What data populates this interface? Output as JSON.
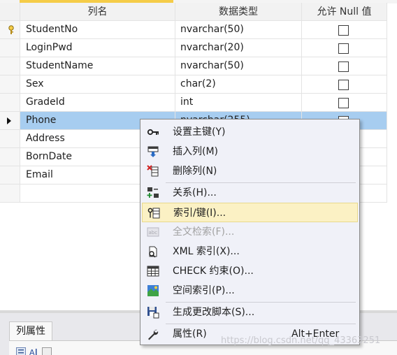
{
  "grid": {
    "headers": [
      "列名",
      "数据类型",
      "允许 Null 值"
    ],
    "rows": [
      {
        "name": "StudentNo",
        "type": "nvarchar(50)",
        "allow_null": false
      },
      {
        "name": "LoginPwd",
        "type": "nvarchar(20)",
        "allow_null": false
      },
      {
        "name": "StudentName",
        "type": "nvarchar(50)",
        "allow_null": false
      },
      {
        "name": "Sex",
        "type": "char(2)",
        "allow_null": false
      },
      {
        "name": "GradeId",
        "type": "int",
        "allow_null": false
      },
      {
        "name": "Phone",
        "type": "nvarchar(255)",
        "allow_null": false
      },
      {
        "name": "Address",
        "type": "",
        "allow_null": false
      },
      {
        "name": "BornDate",
        "type": "",
        "allow_null": false
      },
      {
        "name": "Email",
        "type": "",
        "allow_null": false
      }
    ]
  },
  "context_menu": {
    "items": [
      {
        "label": "设置主键(Y)",
        "icon": "primary-key-icon"
      },
      {
        "label": "插入列(M)",
        "icon": "insert-column-icon"
      },
      {
        "label": "删除列(N)",
        "icon": "delete-column-icon"
      },
      {
        "label": "关系(H)...",
        "icon": "relationships-icon"
      },
      {
        "label": "索引/键(I)...",
        "icon": "indexes-keys-icon"
      },
      {
        "label": "全文检索(F)...",
        "icon": "fulltext-index-icon",
        "disabled": true
      },
      {
        "label": "XML 索引(X)...",
        "icon": "xml-index-icon"
      },
      {
        "label": "CHECK 约束(O)...",
        "icon": "check-constraint-icon"
      },
      {
        "label": "空间索引(P)...",
        "icon": "spatial-index-icon"
      },
      {
        "label": "生成更改脚本(S)...",
        "icon": "generate-script-icon"
      },
      {
        "label": "属性(R)",
        "icon": "properties-wrench-icon",
        "shortcut": "Alt+Enter"
      }
    ]
  },
  "properties_panel": {
    "tab_label": "列属性"
  },
  "watermark": "https://blog.csdn.net/qq_43363251",
  "colors": {
    "selection": "#a7cdf0",
    "menu_bg": "#f0f1f8",
    "menu_hover": "#fbf1c4",
    "key_icon": "#f5cc48"
  }
}
